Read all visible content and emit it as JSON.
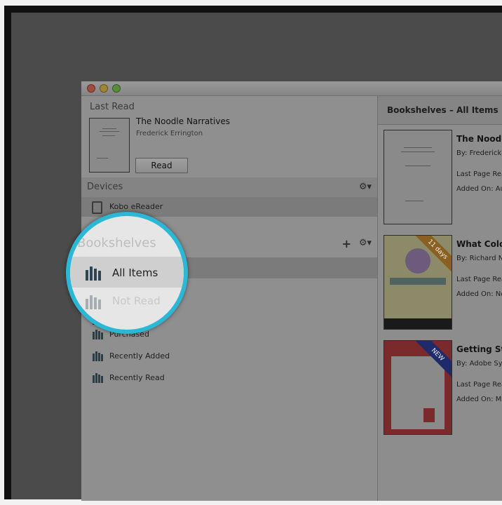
{
  "window": {
    "title": ""
  },
  "last_read": {
    "header": "Last Read",
    "title": "The Noodle Narratives",
    "author": "Frederick Errington",
    "read_button": "Read"
  },
  "devices": {
    "header": "Devices",
    "items": [
      {
        "label": "Kobo eReader"
      }
    ]
  },
  "bookshelves": {
    "header": "Bookshelves",
    "items": [
      {
        "label": "All Items"
      },
      {
        "label": "Not Read"
      },
      {
        "label": "Purchased"
      },
      {
        "label": "Recently Added"
      },
      {
        "label": "Recently Read"
      }
    ]
  },
  "content": {
    "header": "Bookshelves – All Items",
    "books": [
      {
        "title": "The Noodl",
        "author": "By: Frederick",
        "last_page": "Last Page Rea",
        "added": "Added On: Au",
        "badge": ""
      },
      {
        "title": "What Colo",
        "author": "By: Richard N",
        "last_page": "Last Page Rea",
        "added": "Added On: No",
        "badge": "11 days"
      },
      {
        "title": "Getting Sta",
        "author": "By: Adobe Sys",
        "last_page": "Last Page Rea",
        "added": "Added On: Ma",
        "badge": "NEW"
      }
    ]
  },
  "icons": {
    "gear": "gear-icon",
    "plus": "plus-icon",
    "device": "ereader-icon",
    "bookshelf": "bookshelf-icon"
  },
  "colors": {
    "magnifier_ring": "#2bb7d6",
    "badge_days": "#b07a2a",
    "badge_new": "#2a3a8a"
  }
}
